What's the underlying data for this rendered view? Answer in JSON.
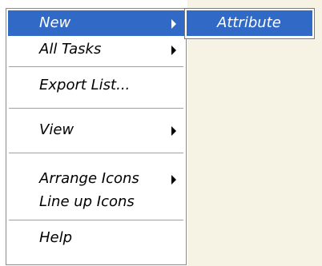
{
  "context_menu": {
    "items": [
      {
        "label": "New",
        "has_submenu": true,
        "highlighted": true
      },
      {
        "label": "All Tasks",
        "has_submenu": true
      },
      {
        "label": "Export List...",
        "has_submenu": false
      },
      {
        "label": "View",
        "has_submenu": true
      },
      {
        "label": "Arrange Icons",
        "has_submenu": true
      },
      {
        "label": "Line up Icons",
        "has_submenu": false
      },
      {
        "label": "Help",
        "has_submenu": false
      }
    ]
  },
  "submenu": {
    "items": [
      {
        "label": "Attribute",
        "highlighted": true
      }
    ]
  },
  "colors": {
    "highlight": "#3169c6",
    "highlight_text": "#ffffff",
    "menu_background": "#ffffff",
    "pane_background": "#f7f3e4"
  }
}
